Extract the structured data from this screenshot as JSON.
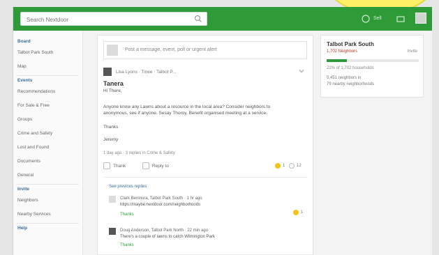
{
  "header": {
    "search_placeholder": "Search Nextdoor",
    "tb_label": "Sell"
  },
  "sidebar": {
    "items": [
      {
        "label": "Board",
        "kind": "head"
      },
      {
        "label": "Talbot Park South",
        "kind": "item"
      },
      {
        "label": "Map",
        "kind": "item"
      },
      {
        "label": "Events",
        "kind": "head"
      },
      {
        "label": "Recommendations",
        "kind": "item"
      },
      {
        "label": "For Sale & Free",
        "kind": "item"
      },
      {
        "label": "Groups",
        "kind": "item"
      },
      {
        "label": "Crime and Safety",
        "kind": "item"
      },
      {
        "label": "Lost and Found",
        "kind": "item"
      },
      {
        "label": "Documents",
        "kind": "item"
      },
      {
        "label": "General",
        "kind": "item"
      },
      {
        "label": "Invite",
        "kind": "head"
      },
      {
        "label": "Neighbors",
        "kind": "item"
      },
      {
        "label": "Nearby Services",
        "kind": "item"
      },
      {
        "label": "Help",
        "kind": "head"
      }
    ]
  },
  "composer": {
    "placeholder": "Post a message, event, poll or urgent alert"
  },
  "post": {
    "meta": "Lisa Lyons · Tinee · Talbot P...",
    "title": "Tanera",
    "greeting": "Hi There,",
    "body": "Anyone know any Lawns about a resource in the local area? Consider neighbors to anonymous, see if anyone. Sesay Thoroy, Benefit organised meeting at a service.",
    "line_thanks": "Thanks",
    "line_sign": "Jeremy",
    "stamp": "1 day ago · 3 replies in Crime & Safety",
    "action_thank": "Thank",
    "action_reply": "Reply to",
    "react_count": "1",
    "reply_count": "12"
  },
  "previous_link": "See previous replies",
  "comments": [
    {
      "meta": "Clark Beninura, Talbot Park South · 1 hr ago",
      "text": "https://maybe.nextdoor.com/neighborhoods",
      "link": "Thanks",
      "react": "1",
      "avatar_color": "#dcdcdc"
    },
    {
      "meta": "Doug Anderson, Talbot Park North · 22 min ago",
      "text": "There's a couple of lawns to catch Wilmington Park",
      "link": "Thanks",
      "react": "",
      "avatar_color": "#555555"
    }
  ],
  "widget": {
    "title": "Talbot Park South",
    "sub": "1,702 Neighbors",
    "sub_right": "Invite",
    "progress": 0.22,
    "stat": "22% of 1,702 households",
    "line1": "5,451 neighbors in",
    "line2": "79 nearby neighborhoods"
  },
  "colors": {
    "brand_green": "#2f9b38",
    "accent_yellow": "#f2c31a",
    "link_blue": "#3a6e9a"
  }
}
